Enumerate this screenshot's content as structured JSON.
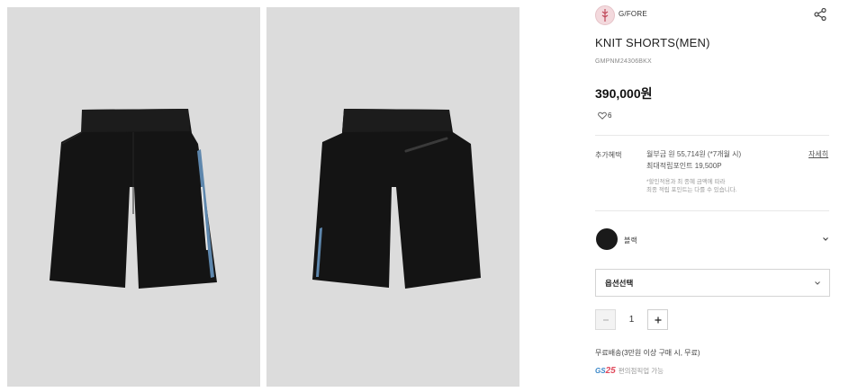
{
  "gallery": {
    "images": [
      {
        "name": "front-view"
      },
      {
        "name": "back-view"
      }
    ]
  },
  "brand": {
    "name": "G/FORE"
  },
  "product": {
    "name": "KNIT SHORTS(MEN)",
    "code": "GMPNM24306BKX",
    "price": "390,000원",
    "likes": "6"
  },
  "benefits": {
    "label": "추가혜택",
    "installment": "월부금 원 55,714원 (*7개월 시)",
    "points": "최대적립포인트 19,500P",
    "note_line1": "*할인적용과 최 종혜 금액에 따라",
    "note_line2": "최종 적립 포인트는 다를 수 있습니다.",
    "detail_link": "자세히"
  },
  "color": {
    "name": "블랙",
    "swatch": "#1a1a1a"
  },
  "option": {
    "placeholder": "옵션선택"
  },
  "quantity": {
    "value": "1",
    "minus": "−",
    "plus": "+"
  },
  "shipping": {
    "text": "무료배송(3만원 이상 구매 시, 무료)",
    "gs25_prefix": "GS",
    "gs25_number": "25",
    "gs25_text": "편의점픽업 가능"
  },
  "icons": {
    "share": "share-icon",
    "like": "heart-icon",
    "chevron": "chevron-down-icon"
  }
}
